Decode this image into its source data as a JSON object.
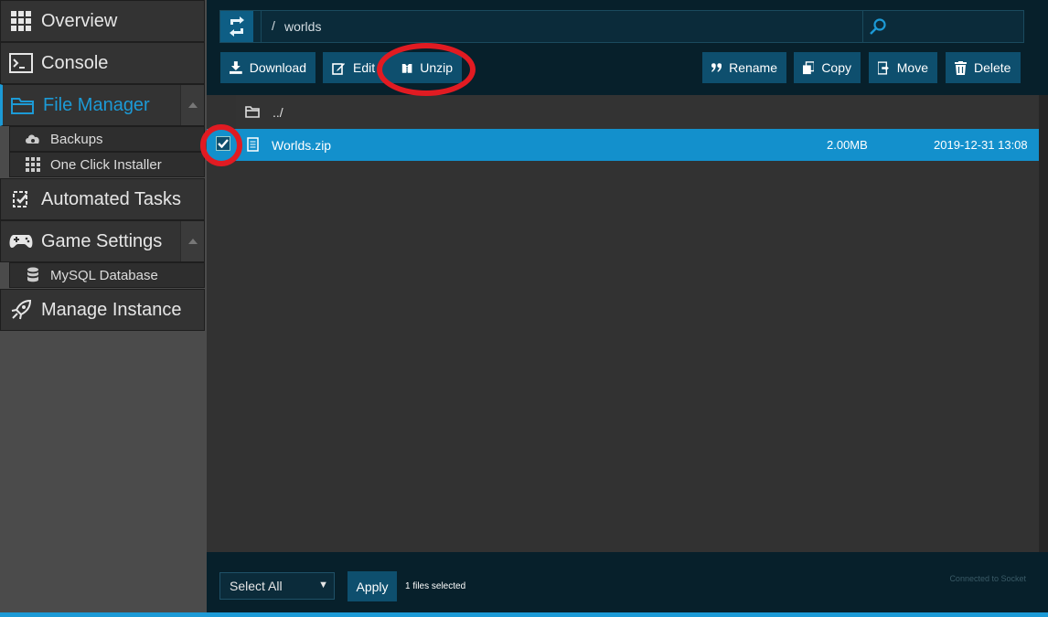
{
  "sidebar": {
    "items": [
      {
        "label": "Overview",
        "icon": "grid-icon"
      },
      {
        "label": "Console",
        "icon": "terminal-icon"
      },
      {
        "label": "File Manager",
        "icon": "folder-icon",
        "active": true
      },
      {
        "label": "Automated Tasks",
        "icon": "tasks-icon"
      },
      {
        "label": "Game Settings",
        "icon": "gamepad-icon"
      },
      {
        "label": "Manage Instance",
        "icon": "rocket-icon"
      }
    ],
    "subitems": {
      "file_manager": [
        {
          "label": "Backups",
          "icon": "cloud-icon"
        },
        {
          "label": "One Click Installer",
          "icon": "grid-icon"
        }
      ],
      "game_settings": [
        {
          "label": "MySQL Database",
          "icon": "database-icon"
        }
      ]
    }
  },
  "path": {
    "separator": "/",
    "current": "worlds"
  },
  "toolbar": {
    "download": "Download",
    "edit": "Edit",
    "unzip": "Unzip",
    "rename": "Rename",
    "copy": "Copy",
    "move": "Move",
    "delete": "Delete"
  },
  "files": {
    "parent": "../",
    "rows": [
      {
        "name": "Worlds.zip",
        "size": "2.00MB",
        "date": "2019-12-31 13:08",
        "selected": true
      }
    ]
  },
  "footer": {
    "select_value": "Select All",
    "apply": "Apply",
    "selected_count": "1 files selected",
    "socket_status": "Connected to Socket"
  },
  "colors": {
    "accent": "#1c9ad6",
    "button": "#0e4f6e",
    "annotation": "#e11b22"
  }
}
